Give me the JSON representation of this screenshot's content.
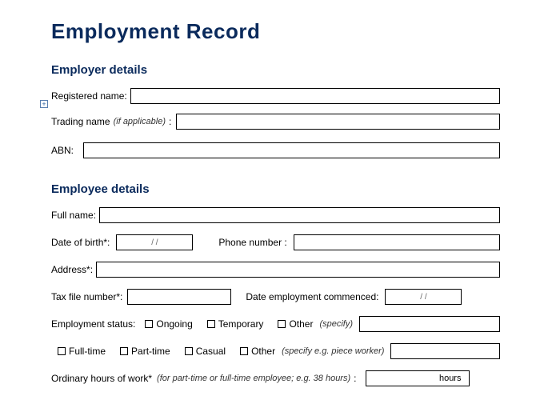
{
  "title": "Employment Record",
  "sections": {
    "employer": {
      "heading": "Employer details",
      "registered_name_label": "Registered name:",
      "trading_name_label": "Trading name",
      "trading_name_hint": "(if applicable)",
      "trading_name_colon": ":",
      "abn_label": "ABN:"
    },
    "employee": {
      "heading": "Employee details",
      "full_name_label": "Full name:",
      "dob_label": "Date of birth*:",
      "dob_placeholder": "/        /",
      "phone_label": "Phone number  :",
      "address_label": "Address*:",
      "tfn_label": "Tax file number*:",
      "commenced_label": "Date employment commenced:",
      "commenced_placeholder": "/        /",
      "status_label": "Employment status:",
      "status_options": {
        "ongoing": "Ongoing",
        "temporary": "Temporary",
        "other": "Other"
      },
      "status_other_hint": "(specify)",
      "type_options": {
        "fulltime": "Full-time",
        "parttime": "Part-time",
        "casual": "Casual",
        "other": "Other"
      },
      "type_other_hint": "(specify e.g. piece worker)",
      "hours_label": "Ordinary hours of work*",
      "hours_hint": "(for part-time or full-time employee; e.g. 38 hours)",
      "hours_colon": ":",
      "hours_unit": "hours"
    }
  }
}
